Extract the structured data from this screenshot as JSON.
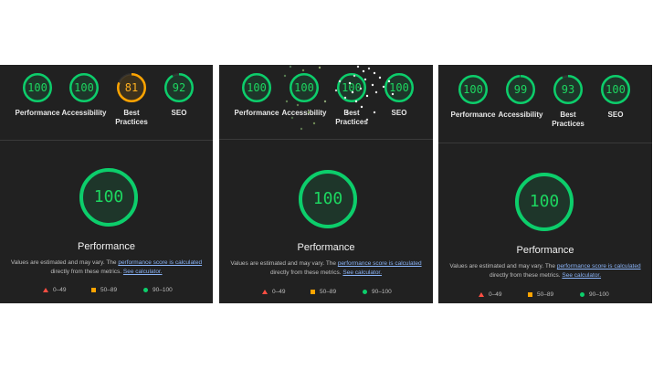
{
  "panels": [
    {
      "gauges": [
        {
          "value": "100",
          "label": "Performance",
          "score": 100
        },
        {
          "value": "100",
          "label": "Accessibility",
          "score": 100
        },
        {
          "value": "81",
          "label": "Best Practices",
          "score": 81
        },
        {
          "value": "92",
          "label": "SEO",
          "score": 92
        }
      ],
      "main": {
        "value": "100",
        "title": "Performance"
      }
    },
    {
      "gauges": [
        {
          "value": "100",
          "label": "Performance",
          "score": 100
        },
        {
          "value": "100",
          "label": "Accessibility",
          "score": 100
        },
        {
          "value": "100",
          "label": "Best Practices",
          "score": 100
        },
        {
          "value": "100",
          "label": "SEO",
          "score": 100
        }
      ],
      "main": {
        "value": "100",
        "title": "Performance"
      }
    },
    {
      "gauges": [
        {
          "value": "100",
          "label": "Performance",
          "score": 100
        },
        {
          "value": "99",
          "label": "Accessibility",
          "score": 99
        },
        {
          "value": "93",
          "label": "Best Practices",
          "score": 93
        },
        {
          "value": "100",
          "label": "SEO",
          "score": 100
        }
      ],
      "main": {
        "value": "100",
        "title": "Performance"
      }
    }
  ],
  "note": {
    "prefix": "Values are estimated and may vary. The ",
    "link1": "performance score is calculated",
    "middle": "directly from these metrics. ",
    "link2": "See calculator."
  },
  "legend": {
    "fail": "0–49",
    "average": "50–89",
    "pass": "90–100"
  },
  "colors": {
    "pass": "#0cce6b",
    "average": "#ffa400",
    "fail": "#ff4e42"
  }
}
